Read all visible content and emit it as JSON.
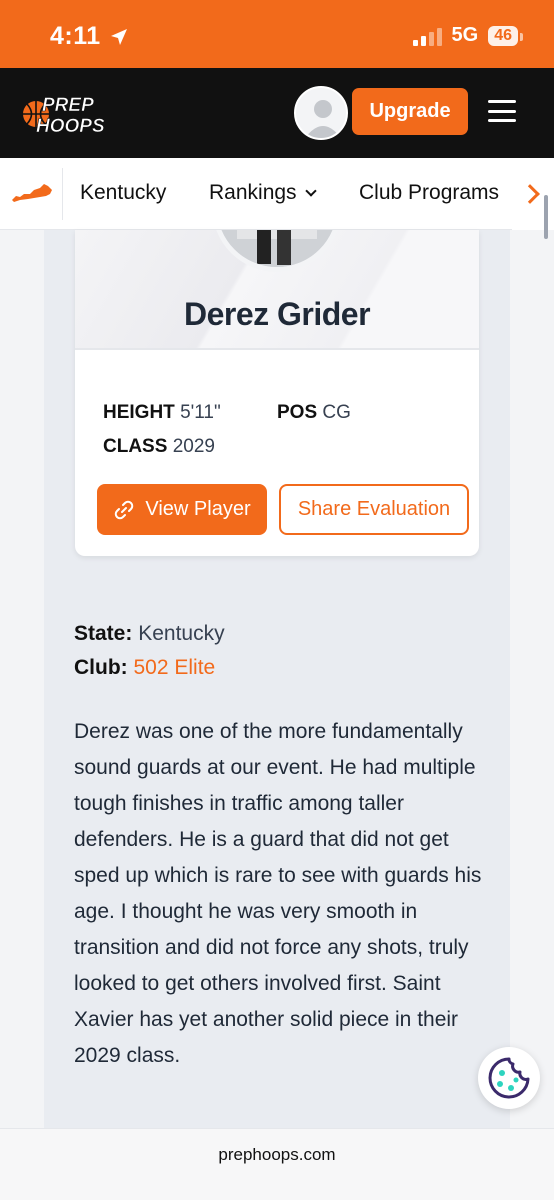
{
  "status_bar": {
    "time": "4:11",
    "network": "5G",
    "battery": "46"
  },
  "header": {
    "logo_line1": "PREP",
    "logo_line2": "HOOPS",
    "upgrade_label": "Upgrade"
  },
  "state_nav": {
    "items": [
      {
        "label": "Kentucky"
      },
      {
        "label": "Rankings"
      },
      {
        "label": "Club Programs"
      }
    ]
  },
  "player": {
    "name": "Derez Grider",
    "height_label": "HEIGHT",
    "height_value": "5'11\"",
    "pos_label": "POS",
    "pos_value": "CG",
    "class_label": "CLASS",
    "class_value": "2029",
    "view_button": "View Player",
    "share_button": "Share Evaluation"
  },
  "details": {
    "state_label": "State:",
    "state_value": "Kentucky",
    "club_label": "Club:",
    "club_value": "502 Elite"
  },
  "evaluation": {
    "text": "Derez was one of the more fundamentally sound guards at our event. He had multiple tough finishes in traffic among taller defenders. He is a guard that did not get sped up which is rare to see with guards his age. I thought he was very smooth in transition and did not force any shots, truly looked to get others involved first. Saint Xavier has yet another solid piece in their 2029 class."
  },
  "browser": {
    "url": "prephoops.com"
  },
  "colors": {
    "brand_orange": "#f26a1b",
    "nav_black": "#111111"
  }
}
